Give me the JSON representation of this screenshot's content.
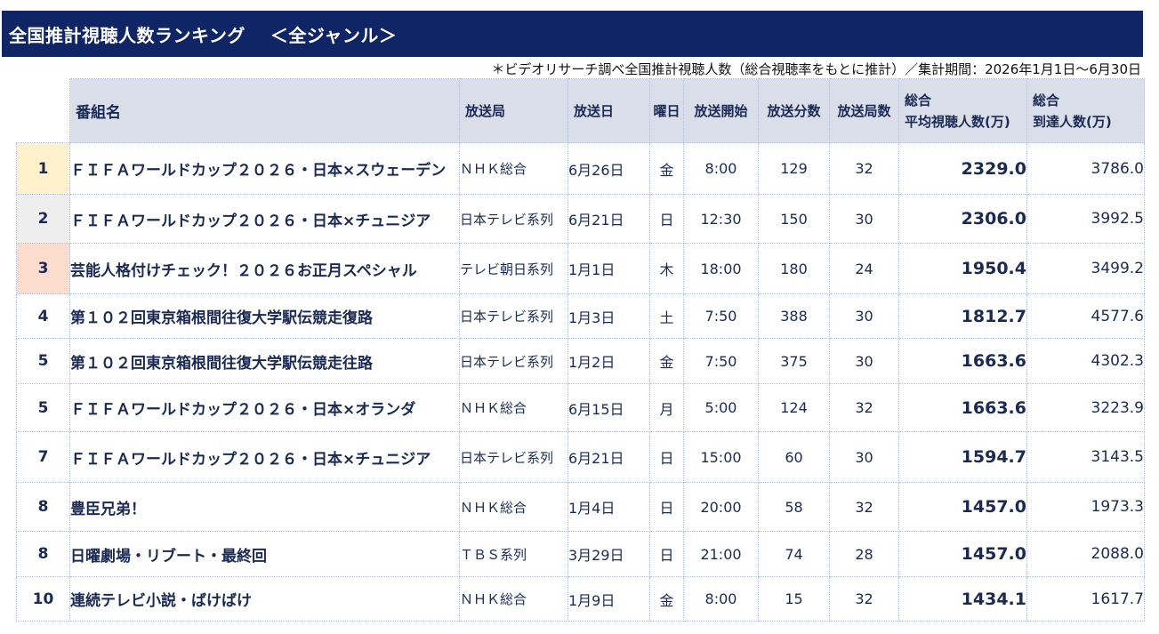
{
  "title": "全国推計視聴人数ランキング",
  "genre": "＜全ジャンル＞",
  "note": "＊ビデオリサーチ調べ全国推計視聴人数（総合視聴率をもとに推計）／集計期間：2026年1月1日～6月30日",
  "headers": {
    "program": "番組名",
    "station": "放送局",
    "date": "放送日",
    "weekday": "曜日",
    "start": "放送開始",
    "minutes": "放送分数",
    "stations": "放送局数",
    "avg_line1": "総合",
    "avg_line2": "平均視聴人数(万)",
    "reach_line1": "総合",
    "reach_line2": "到達人数(万)"
  },
  "rows": [
    {
      "rank": "1",
      "program": "ＦＩＦＡワールドカップ２０２６・日本×スウェーデン",
      "station": "ＮＨＫ総合",
      "date": "6月26日",
      "weekday": "金",
      "start": "8:00",
      "minutes": "129",
      "stations": "32",
      "avg": "2329.0",
      "reach": "3786.0"
    },
    {
      "rank": "2",
      "program": "ＦＩＦＡワールドカップ２０２６・日本×チュニジア",
      "station": "日本テレビ系列",
      "date": "6月21日",
      "weekday": "日",
      "start": "12:30",
      "minutes": "150",
      "stations": "30",
      "avg": "2306.0",
      "reach": "3992.5"
    },
    {
      "rank": "3",
      "program": "芸能人格付けチェック！２０２６お正月スペシャル",
      "station": "テレビ朝日系列",
      "date": "1月1日",
      "weekday": "木",
      "start": "18:00",
      "minutes": "180",
      "stations": "24",
      "avg": "1950.4",
      "reach": "3499.2"
    },
    {
      "rank": "4",
      "program": "第１０２回東京箱根間往復大学駅伝競走復路",
      "station": "日本テレビ系列",
      "date": "1月3日",
      "weekday": "土",
      "start": "7:50",
      "minutes": "388",
      "stations": "30",
      "avg": "1812.7",
      "reach": "4577.6"
    },
    {
      "rank": "5",
      "program": "第１０２回東京箱根間往復大学駅伝競走往路",
      "station": "日本テレビ系列",
      "date": "1月2日",
      "weekday": "金",
      "start": "7:50",
      "minutes": "375",
      "stations": "30",
      "avg": "1663.6",
      "reach": "4302.3"
    },
    {
      "rank": "5",
      "program": "ＦＩＦＡワールドカップ２０２６・日本×オランダ",
      "station": "ＮＨＫ総合",
      "date": "6月15日",
      "weekday": "月",
      "start": "5:00",
      "minutes": "124",
      "stations": "32",
      "avg": "1663.6",
      "reach": "3223.9"
    },
    {
      "rank": "7",
      "program": "ＦＩＦＡワールドカップ２０２６・日本×チュニジア",
      "station": "日本テレビ系列",
      "date": "6月21日",
      "weekday": "日",
      "start": "15:00",
      "minutes": "60",
      "stations": "30",
      "avg": "1594.7",
      "reach": "3143.5"
    },
    {
      "rank": "8",
      "program": "豊臣兄弟！",
      "station": "ＮＨＫ総合",
      "date": "1月4日",
      "weekday": "日",
      "start": "20:00",
      "minutes": "58",
      "stations": "32",
      "avg": "1457.0",
      "reach": "1973.3"
    },
    {
      "rank": "8",
      "program": "日曜劇場・リブート・最終回",
      "station": "ＴＢＳ系列",
      "date": "3月29日",
      "weekday": "日",
      "start": "21:00",
      "minutes": "74",
      "stations": "28",
      "avg": "1457.0",
      "reach": "2088.0"
    },
    {
      "rank": "10",
      "program": "連続テレビ小説・ばけばけ",
      "station": "ＮＨＫ総合",
      "date": "1月9日",
      "weekday": "金",
      "start": "8:00",
      "minutes": "15",
      "stations": "32",
      "avg": "1434.1",
      "reach": "1617.7"
    }
  ],
  "colors": {
    "title_bg": "#102566",
    "header_bg": "#d9dee9",
    "rank1_bg": "#fff1cc",
    "rank2_bg": "#eeeeee",
    "rank3_bg": "#fbdccd",
    "text": "#1a2a55"
  }
}
